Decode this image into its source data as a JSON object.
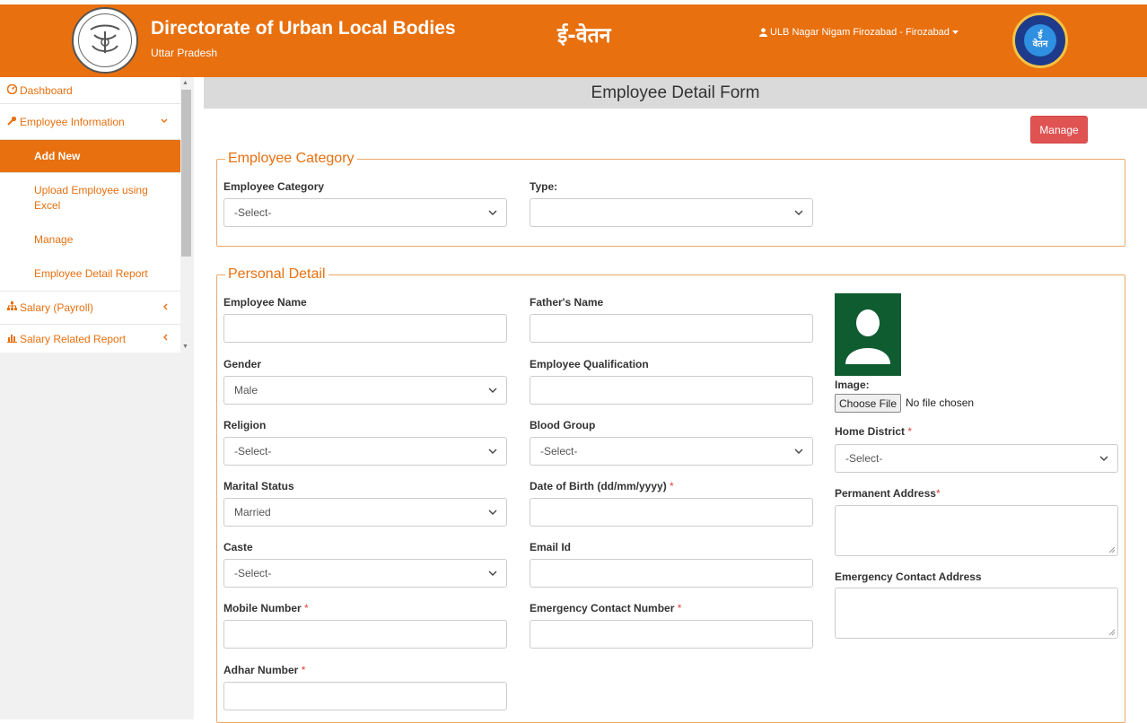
{
  "header": {
    "title": "Directorate of Urban Local Bodies",
    "subtitle": "Uttar Pradesh",
    "app_name": "ई-वेतन",
    "user_label": "ULB Nagar Nigam Firozabad - Firozabad",
    "right_logo_text": "ई\nवेतन",
    "brand_color": "#e8700f"
  },
  "sidebar": {
    "items": [
      {
        "label": "Dashboard",
        "icon": "dashboard-icon"
      },
      {
        "label": "Employee Information",
        "icon": "wrench-icon",
        "expanded": true
      },
      {
        "label": "Add New",
        "active": true
      },
      {
        "label": "Upload Employee using Excel"
      },
      {
        "label": "Manage"
      },
      {
        "label": "Employee Detail Report"
      },
      {
        "label": "Salary (Payroll)",
        "icon": "sitemap-icon"
      },
      {
        "label": "Salary Related Report",
        "icon": "bar-chart-icon"
      }
    ]
  },
  "page": {
    "title": "Employee Detail Form",
    "manage_label": "Manage"
  },
  "employee_category": {
    "legend": "Employee Category",
    "category_label": "Employee Category",
    "category_value": "-Select-",
    "type_label": "Type:",
    "type_value": ""
  },
  "personal": {
    "legend": "Personal Detail",
    "employee_name_label": "Employee Name",
    "fathers_name_label": "Father's Name",
    "gender_label": "Gender",
    "gender_value": "Male",
    "qualification_label": "Employee Qualification",
    "religion_label": "Religion",
    "religion_value": "-Select-",
    "blood_group_label": "Blood Group",
    "blood_group_value": "-Select-",
    "marital_label": "Marital Status",
    "marital_value": "Married",
    "dob_label": "Date of Birth (dd/mm/yyyy)",
    "caste_label": "Caste",
    "caste_value": "-Select-",
    "email_label": "Email Id",
    "mobile_label": "Mobile Number",
    "emergency_number_label": "Emergency Contact Number",
    "adhar_label": "Adhar Number",
    "image_label": "Image:",
    "choose_file_label": "Choose File",
    "file_status": "No file chosen",
    "home_district_label": "Home District",
    "home_district_value": "-Select-",
    "permanent_address_label": "Permanent Address",
    "emergency_address_label": "Emergency Contact Address",
    "required_mark": "*"
  }
}
